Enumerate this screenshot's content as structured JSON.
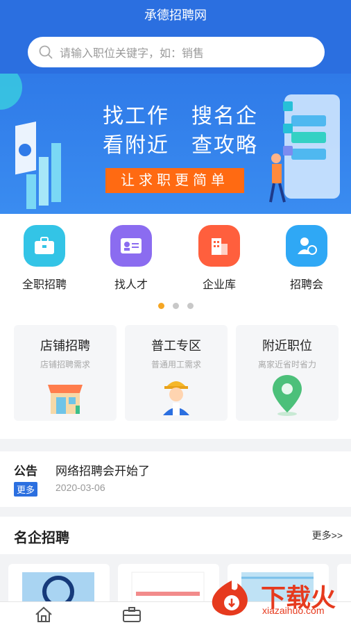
{
  "header": {
    "title": "承德招聘网",
    "search_placeholder": "请输入职位关键字，如：销售"
  },
  "banner": {
    "line1_left": "找工作",
    "line1_right": "搜名企",
    "line2_left": "看附近",
    "line2_right": "查攻略",
    "cta": "让求职更简单"
  },
  "quick_links": [
    {
      "label": "全职招聘",
      "icon": "briefcase-icon",
      "color": "#33c4e6"
    },
    {
      "label": "找人才",
      "icon": "id-card-icon",
      "color": "#8b6cf0"
    },
    {
      "label": "企业库",
      "icon": "building-icon",
      "color": "#ff5f3d"
    },
    {
      "label": "招聘会",
      "icon": "person-badge-icon",
      "color": "#2fa8f5"
    }
  ],
  "carousel": {
    "active_index": 0,
    "count": 3
  },
  "feature_cards": [
    {
      "title": "店铺招聘",
      "sub": "店铺招聘需求",
      "icon": "shop-icon"
    },
    {
      "title": "普工专区",
      "sub": "普通用工需求",
      "icon": "worker-icon"
    },
    {
      "title": "附近职位",
      "sub": "离家近省时省力",
      "icon": "location-pin-icon"
    }
  ],
  "notice": {
    "label": "公告",
    "badge": "更多",
    "text": "网络招聘会开始了",
    "date": "2020-03-06"
  },
  "famous": {
    "title": "名企招聘",
    "more": "更多>>"
  },
  "tabbar": [
    {
      "icon": "home-icon"
    },
    {
      "icon": "briefcase-icon"
    }
  ],
  "watermark": {
    "brand": "下载火",
    "url": "xiazaihuo.com"
  },
  "colors": {
    "primary": "#2b6fe0",
    "accent": "#ff6a12",
    "dot_active": "#f5a623"
  }
}
